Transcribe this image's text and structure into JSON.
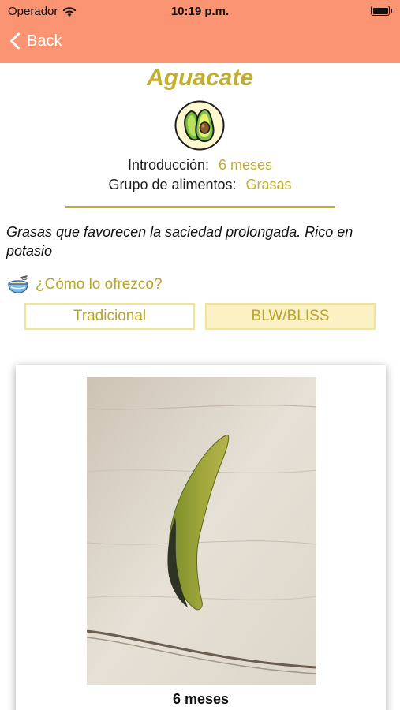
{
  "status_bar": {
    "carrier": "Operador",
    "time": "10:19 p.m.",
    "wifi_icon": "wifi-icon",
    "battery_icon": "battery-icon"
  },
  "nav": {
    "back_label": "Back",
    "back_icon": "chevron-left-icon",
    "header_color": "#fb9472"
  },
  "food": {
    "name": "Aguacate",
    "icon": "avocado-icon",
    "introduction_label": "Introducción:",
    "introduction_value": "6 meses",
    "group_label": "Grupo de alimentos:",
    "group_value": "Grasas",
    "description": "Grasas que favorecen la saciedad prolongada. Rico en potasio",
    "accent_color": "#c2ae2f"
  },
  "how_to": {
    "icon": "bowl-icon",
    "label": "¿Cómo lo ofrezco?",
    "tabs": [
      {
        "label": "Tradicional",
        "selected": false
      },
      {
        "label": "BLW/BLISS",
        "selected": true
      }
    ]
  },
  "card": {
    "image": "avocado-slice-photo",
    "caption": "6 meses"
  }
}
